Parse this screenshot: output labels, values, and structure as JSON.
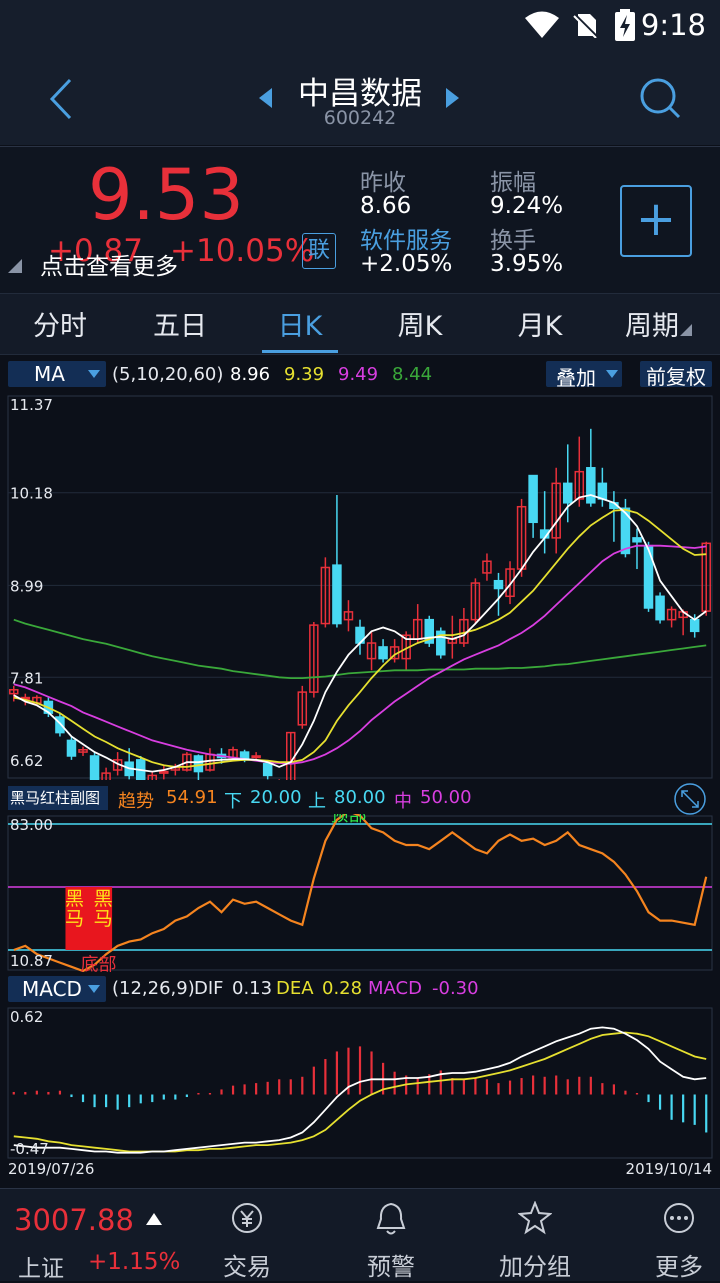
{
  "status": {
    "time": "9:18"
  },
  "header": {
    "title": "中昌数据",
    "code": "600242"
  },
  "quote": {
    "price": "9.53",
    "change": "+0.87",
    "change_pct": "+10.05%",
    "lian": "联",
    "overlay_text": "点击查看更多",
    "prev_close_label": "昨收",
    "prev_close": "8.66",
    "amplitude_label": "振幅",
    "amplitude": "9.24%",
    "sector": "软件服务",
    "sector_change": "+2.05%",
    "turnover_label": "换手",
    "turnover": "3.95%",
    "add_label": "+"
  },
  "tabs": [
    "分时",
    "五日",
    "日K",
    "周K",
    "月K",
    "周期"
  ],
  "ma": {
    "name": "MA",
    "params": "(5,10,20,60)",
    "v5": "8.96",
    "v10": "9.39",
    "v20": "9.49",
    "v60": "8.44",
    "overlay": "叠加",
    "adjust": "前复权"
  },
  "colors": {
    "up": "#e8303a",
    "down": "#48d8f2",
    "ma5": "#ffffff",
    "ma10": "#e6e030",
    "ma20": "#d83ee0",
    "ma60": "#3aa83a",
    "trend": "#f5841f"
  },
  "chart_data": [
    {
      "type": "candlestick",
      "ylim": [
        6.62,
        11.37
      ],
      "y_ticks": [
        "11.37",
        "10.18",
        "8.99",
        "7.81",
        "6.62"
      ],
      "x_start": "2019/07/26",
      "x_end": "2019/10/14",
      "candles": [
        [
          7.6,
          7.65,
          7.5,
          7.7
        ],
        [
          7.55,
          7.55,
          7.45,
          7.6
        ],
        [
          7.48,
          7.55,
          7.45,
          7.58
        ],
        [
          7.5,
          7.35,
          7.3,
          7.55
        ],
        [
          7.3,
          7.1,
          7.05,
          7.35
        ],
        [
          7.0,
          6.8,
          6.75,
          7.05
        ],
        [
          6.85,
          6.88,
          6.8,
          6.92
        ],
        [
          6.8,
          6.45,
          6.38,
          6.85
        ],
        [
          6.48,
          6.58,
          6.45,
          6.65
        ],
        [
          6.62,
          6.75,
          6.55,
          6.85
        ],
        [
          6.72,
          6.55,
          6.5,
          6.9
        ],
        [
          6.75,
          6.4,
          6.35,
          6.8
        ],
        [
          6.4,
          6.55,
          6.35,
          6.6
        ],
        [
          6.58,
          6.6,
          6.5,
          6.68
        ],
        [
          6.62,
          6.65,
          6.55,
          6.7
        ],
        [
          6.62,
          6.82,
          6.6,
          6.85
        ],
        [
          6.8,
          6.6,
          6.45,
          6.82
        ],
        [
          6.62,
          6.82,
          6.6,
          6.9
        ],
        [
          6.82,
          6.78,
          6.7,
          6.9
        ],
        [
          6.78,
          6.88,
          6.75,
          6.92
        ],
        [
          6.85,
          6.75,
          6.72,
          6.88
        ],
        [
          6.8,
          6.8,
          6.75,
          6.85
        ],
        [
          6.7,
          6.55,
          6.5,
          6.72
        ],
        [
          6.38,
          6.48,
          6.35,
          6.5
        ],
        [
          6.42,
          7.1,
          6.4,
          7.1
        ],
        [
          7.2,
          7.62,
          7.15,
          7.7
        ],
        [
          7.62,
          8.48,
          7.55,
          8.52
        ],
        [
          8.5,
          9.22,
          8.45,
          9.35
        ],
        [
          9.25,
          8.5,
          8.45,
          10.15
        ],
        [
          8.55,
          8.65,
          8.4,
          8.8
        ],
        [
          8.45,
          8.25,
          8.1,
          8.55
        ],
        [
          8.05,
          8.25,
          7.9,
          8.4
        ],
        [
          8.2,
          8.05,
          8.0,
          8.3
        ],
        [
          8.05,
          8.2,
          8.0,
          8.3
        ],
        [
          8.05,
          8.35,
          7.9,
          8.4
        ],
        [
          8.3,
          8.55,
          8.25,
          8.75
        ],
        [
          8.55,
          8.25,
          8.2,
          8.6
        ],
        [
          8.4,
          8.1,
          8.05,
          8.45
        ],
        [
          8.25,
          8.3,
          8.05,
          8.6
        ],
        [
          8.25,
          8.55,
          8.2,
          8.7
        ],
        [
          8.55,
          9.02,
          8.5,
          9.08
        ],
        [
          9.15,
          9.3,
          9.05,
          9.4
        ],
        [
          9.05,
          8.95,
          8.6,
          9.15
        ],
        [
          8.85,
          9.2,
          8.75,
          9.3
        ],
        [
          9.2,
          10.0,
          9.1,
          10.1
        ],
        [
          10.4,
          9.8,
          9.6,
          10.15
        ],
        [
          9.7,
          9.6,
          9.4,
          10.2
        ],
        [
          9.6,
          10.3,
          9.4,
          10.5
        ],
        [
          10.3,
          10.05,
          9.8,
          10.8
        ],
        [
          10.1,
          10.45,
          10.0,
          10.9
        ],
        [
          10.5,
          10.05,
          10.0,
          11.0
        ],
        [
          10.3,
          10.1,
          10.0,
          10.5
        ],
        [
          10.05,
          9.98,
          9.55,
          10.2
        ],
        [
          9.98,
          9.4,
          9.35,
          10.1
        ],
        [
          9.6,
          9.55,
          9.2,
          9.72
        ],
        [
          9.5,
          8.7,
          8.65,
          9.55
        ],
        [
          8.85,
          8.55,
          8.5,
          8.9
        ],
        [
          8.55,
          8.68,
          8.45,
          8.72
        ],
        [
          8.58,
          8.65,
          8.35,
          8.68
        ],
        [
          8.55,
          8.4,
          8.32,
          8.62
        ],
        [
          8.66,
          9.53,
          8.6,
          9.55
        ]
      ],
      "ma5": [
        7.58,
        7.5,
        7.45,
        7.36,
        7.22,
        7.05,
        6.95,
        6.85,
        6.78,
        6.7,
        6.64,
        6.62,
        6.6,
        6.62,
        6.66,
        6.72,
        6.72,
        6.74,
        6.75,
        6.76,
        6.76,
        6.75,
        6.72,
        6.66,
        6.72,
        6.95,
        7.25,
        7.62,
        7.88,
        8.1,
        8.25,
        8.4,
        8.45,
        8.4,
        8.3,
        8.3,
        8.32,
        8.33,
        8.3,
        8.35,
        8.5,
        8.66,
        8.82,
        9.0,
        9.2,
        9.42,
        9.6,
        9.8,
        10.0,
        10.12,
        10.15,
        10.1,
        10.05,
        9.92,
        9.75,
        9.45,
        9.05,
        8.85,
        8.65,
        8.55,
        8.66
      ],
      "ma10": [
        7.55,
        7.52,
        7.48,
        7.42,
        7.35,
        7.25,
        7.15,
        7.05,
        6.98,
        6.9,
        6.84,
        6.78,
        6.72,
        6.68,
        6.66,
        6.66,
        6.68,
        6.7,
        6.72,
        6.74,
        6.75,
        6.75,
        6.74,
        6.72,
        6.72,
        6.75,
        6.85,
        7.0,
        7.25,
        7.45,
        7.62,
        7.8,
        7.96,
        8.1,
        8.18,
        8.25,
        8.3,
        8.35,
        8.35,
        8.38,
        8.42,
        8.48,
        8.55,
        8.64,
        8.78,
        8.92,
        9.1,
        9.28,
        9.46,
        9.62,
        9.76,
        9.86,
        9.95,
        9.96,
        9.92,
        9.82,
        9.7,
        9.58,
        9.46,
        9.38,
        9.39
      ],
      "ma20": [
        7.72,
        7.68,
        7.62,
        7.56,
        7.5,
        7.44,
        7.36,
        7.3,
        7.24,
        7.18,
        7.12,
        7.06,
        7.0,
        6.96,
        6.92,
        6.88,
        6.85,
        6.82,
        6.8,
        6.78,
        6.76,
        6.74,
        6.72,
        6.71,
        6.7,
        6.72,
        6.76,
        6.82,
        6.9,
        7.0,
        7.12,
        7.26,
        7.38,
        7.5,
        7.6,
        7.7,
        7.8,
        7.88,
        7.96,
        8.04,
        8.1,
        8.16,
        8.22,
        8.3,
        8.38,
        8.48,
        8.6,
        8.74,
        8.88,
        9.02,
        9.16,
        9.3,
        9.4,
        9.46,
        9.5,
        9.5,
        9.5,
        9.49,
        9.48,
        9.47,
        9.49
      ],
      "ma60": [
        8.55,
        8.5,
        8.46,
        8.42,
        8.38,
        8.34,
        8.3,
        8.27,
        8.24,
        8.2,
        8.16,
        8.12,
        8.08,
        8.05,
        8.02,
        7.99,
        7.96,
        7.94,
        7.92,
        7.89,
        7.87,
        7.85,
        7.83,
        7.81,
        7.8,
        7.8,
        7.81,
        7.82,
        7.84,
        7.86,
        7.87,
        7.88,
        7.89,
        7.9,
        7.9,
        7.9,
        7.91,
        7.91,
        7.91,
        7.91,
        7.92,
        7.92,
        7.92,
        7.93,
        7.93,
        7.94,
        7.95,
        7.97,
        7.98,
        8.0,
        8.02,
        8.04,
        8.06,
        8.08,
        8.1,
        8.12,
        8.14,
        8.16,
        8.18,
        8.2,
        8.22
      ]
    },
    {
      "type": "line",
      "title": "黑马红柱副图",
      "ylim": [
        10.87,
        83.0
      ],
      "y_ticks": [
        "83.00",
        "10.87"
      ],
      "trend_label": "趋势",
      "trend_value": "54.91",
      "lower_label": "下",
      "lower_value": "20.00",
      "upper_label": "上",
      "upper_value": "80.00",
      "mid_label": "中",
      "mid_value": "50.00",
      "annot_top": "预部",
      "annot_bottom": "底部",
      "marker": "黑马",
      "values": [
        20,
        22,
        18,
        16,
        14,
        12,
        10,
        13,
        18,
        22,
        24,
        25,
        28,
        30,
        34,
        36,
        40,
        43,
        38,
        44,
        42,
        43,
        40,
        37,
        34,
        32,
        54,
        72,
        82,
        86,
        84,
        78,
        76,
        72,
        70,
        70,
        68,
        72,
        76,
        72,
        68,
        66,
        72,
        75,
        72,
        73,
        70,
        72,
        76,
        70,
        68,
        66,
        62,
        56,
        48,
        38,
        34,
        34,
        33,
        32,
        54.91
      ],
      "marker_index": [
        5,
        8
      ]
    },
    {
      "type": "bar",
      "name": "MACD",
      "params": "(12,26,9)",
      "dif_label": "DIF",
      "dif": "0.13",
      "dea_label": "DEA",
      "dea": "0.28",
      "macd_label": "MACD",
      "macd": "-0.30",
      "ylim": [
        -0.47,
        0.62
      ],
      "y_ticks": [
        "0.62",
        "-0.47"
      ],
      "x_start": "2019/07/26",
      "x_end": "2019/10/14",
      "histogram": [
        0.02,
        0.02,
        0.03,
        0.02,
        0.03,
        -0.02,
        -0.06,
        -0.1,
        -0.1,
        -0.12,
        -0.1,
        -0.07,
        -0.06,
        -0.04,
        -0.04,
        -0.02,
        0.0,
        0.01,
        0.04,
        0.07,
        0.08,
        0.09,
        0.1,
        0.12,
        0.12,
        0.14,
        0.22,
        0.28,
        0.34,
        0.37,
        0.38,
        0.34,
        0.25,
        0.18,
        0.15,
        0.13,
        0.16,
        0.19,
        0.13,
        0.12,
        0.13,
        0.12,
        0.09,
        0.11,
        0.13,
        0.15,
        0.14,
        0.15,
        0.12,
        0.14,
        0.14,
        0.09,
        0.08,
        0.03,
        0.0,
        -0.06,
        -0.12,
        -0.2,
        -0.22,
        -0.24,
        -0.3
      ],
      "dif_values": [
        -0.4,
        -0.41,
        -0.42,
        -0.42,
        -0.42,
        -0.43,
        -0.44,
        -0.45,
        -0.45,
        -0.46,
        -0.46,
        -0.46,
        -0.45,
        -0.45,
        -0.44,
        -0.43,
        -0.42,
        -0.41,
        -0.4,
        -0.39,
        -0.38,
        -0.38,
        -0.37,
        -0.36,
        -0.34,
        -0.3,
        -0.22,
        -0.12,
        -0.02,
        0.06,
        0.1,
        0.12,
        0.12,
        0.12,
        0.13,
        0.13,
        0.14,
        0.16,
        0.17,
        0.17,
        0.18,
        0.2,
        0.22,
        0.25,
        0.3,
        0.34,
        0.38,
        0.42,
        0.45,
        0.48,
        0.52,
        0.53,
        0.52,
        0.48,
        0.43,
        0.36,
        0.26,
        0.2,
        0.14,
        0.12,
        0.13
      ],
      "dea_values": [
        -0.33,
        -0.34,
        -0.35,
        -0.37,
        -0.38,
        -0.4,
        -0.41,
        -0.42,
        -0.43,
        -0.44,
        -0.45,
        -0.45,
        -0.45,
        -0.45,
        -0.45,
        -0.44,
        -0.44,
        -0.43,
        -0.43,
        -0.42,
        -0.41,
        -0.4,
        -0.4,
        -0.39,
        -0.38,
        -0.36,
        -0.33,
        -0.28,
        -0.2,
        -0.12,
        -0.05,
        0.0,
        0.04,
        0.06,
        0.08,
        0.09,
        0.1,
        0.11,
        0.12,
        0.12,
        0.13,
        0.15,
        0.17,
        0.19,
        0.22,
        0.25,
        0.28,
        0.32,
        0.36,
        0.4,
        0.44,
        0.47,
        0.48,
        0.49,
        0.48,
        0.46,
        0.42,
        0.38,
        0.34,
        0.3,
        0.28
      ]
    }
  ],
  "bottom": {
    "index_value": "3007.88",
    "index_name": "上证",
    "index_change": "+1.15%",
    "trade": "交易",
    "alert": "预警",
    "watch": "加分组",
    "more": "更多"
  }
}
